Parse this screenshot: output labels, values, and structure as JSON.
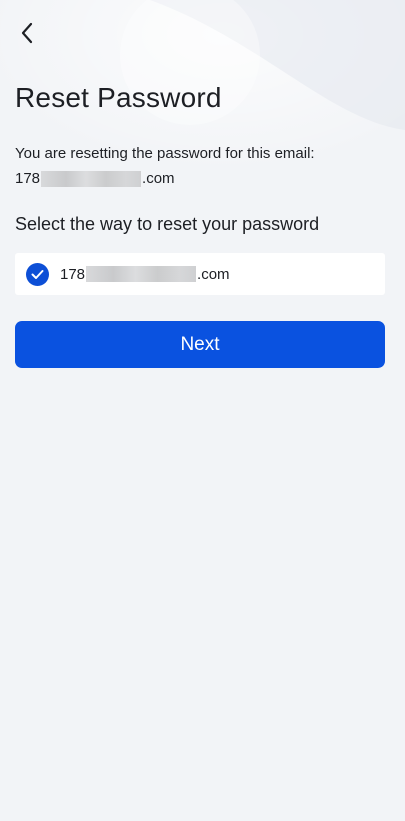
{
  "header": {
    "back_icon": "chevron-left-icon",
    "title": "Reset Password"
  },
  "intro": {
    "text": "You are resetting the password for this email:",
    "email_prefix": "178",
    "email_suffix": ".com"
  },
  "method": {
    "label": "Select the way to reset your password",
    "option_prefix": "178",
    "option_suffix": ".com",
    "selected": true,
    "check_icon": "check-circle-icon"
  },
  "actions": {
    "next_label": "Next"
  },
  "colors": {
    "accent": "#0a52e0",
    "background": "#f2f4f7",
    "text": "#1d1f24"
  }
}
